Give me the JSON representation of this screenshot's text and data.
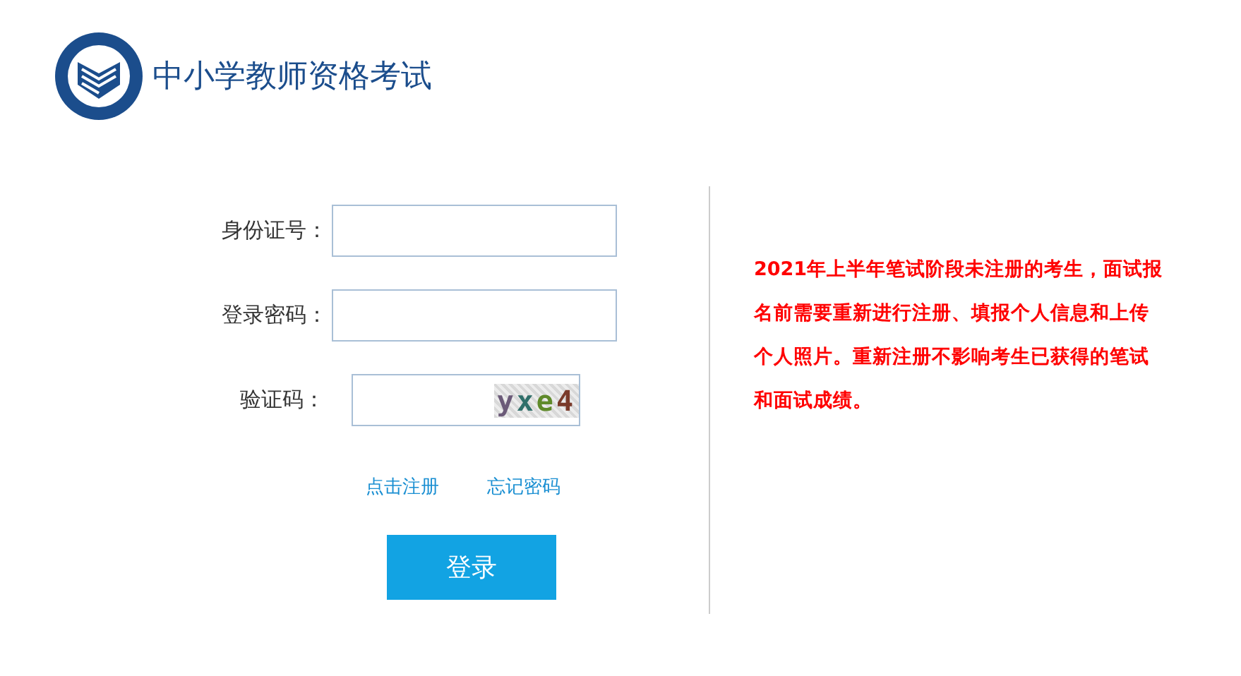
{
  "header": {
    "title": "中小学教师资格考试"
  },
  "form": {
    "fields": [
      {
        "label": "身份证号：",
        "kind": "text"
      },
      {
        "label": "登录密码：",
        "kind": "password"
      },
      {
        "label": "验证码：",
        "kind": "captcha",
        "captcha": "yxe4"
      }
    ],
    "links": [
      "点击注册",
      "忘记密码"
    ],
    "submit": "登录"
  },
  "notice": "2021年上半年笔试阶段未注册的考生，面试报名前需要重新进行注册、填报个人信息和上传个人照片。重新注册不影响考生已获得的笔试和面试成绩。"
}
